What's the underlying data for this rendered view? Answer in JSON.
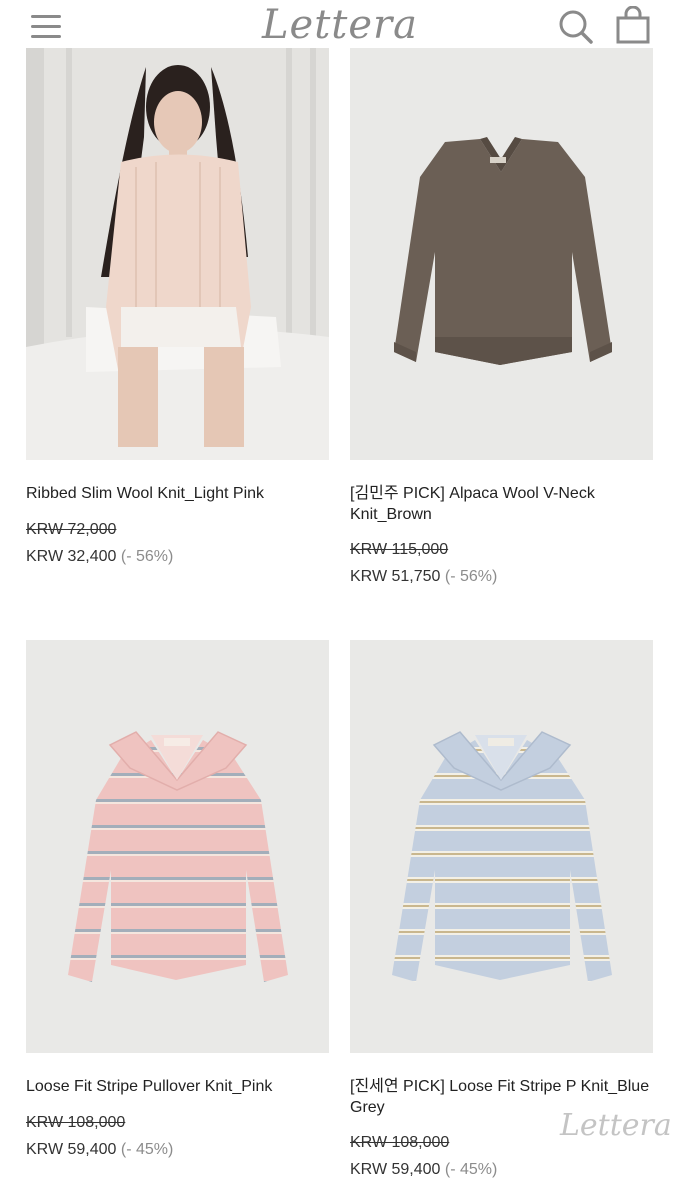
{
  "header": {
    "logo": "Lettera",
    "icons": [
      "menu-icon",
      "search-icon",
      "cart-icon"
    ]
  },
  "products": [
    {
      "name": "Ribbed Slim Wool Knit_Light Pink",
      "original_price": "KRW 72,000",
      "sale_price": "KRW 32,400",
      "discount": "(- 56%)"
    },
    {
      "name": "[김민주 PICK] Alpaca Wool V-Neck Knit_Brown",
      "original_price": "KRW 115,000",
      "sale_price": "KRW 51,750",
      "discount": "(- 56%)"
    },
    {
      "name": "Loose Fit Stripe Pullover Knit_Pink",
      "original_price": "KRW 108,000",
      "sale_price": "KRW 59,400",
      "discount": "(- 45%)"
    },
    {
      "name": "[진세연 PICK] Loose Fit Stripe P Knit_Blue Grey",
      "original_price": "KRW 108,000",
      "sale_price": "KRW 59,400",
      "discount": "(- 45%)"
    }
  ],
  "watermark": "Lettera",
  "colors": {
    "icon_grey": "#8a8a8a",
    "discount_grey": "#8c8c8c",
    "photo_background": "#e8e8e6"
  }
}
